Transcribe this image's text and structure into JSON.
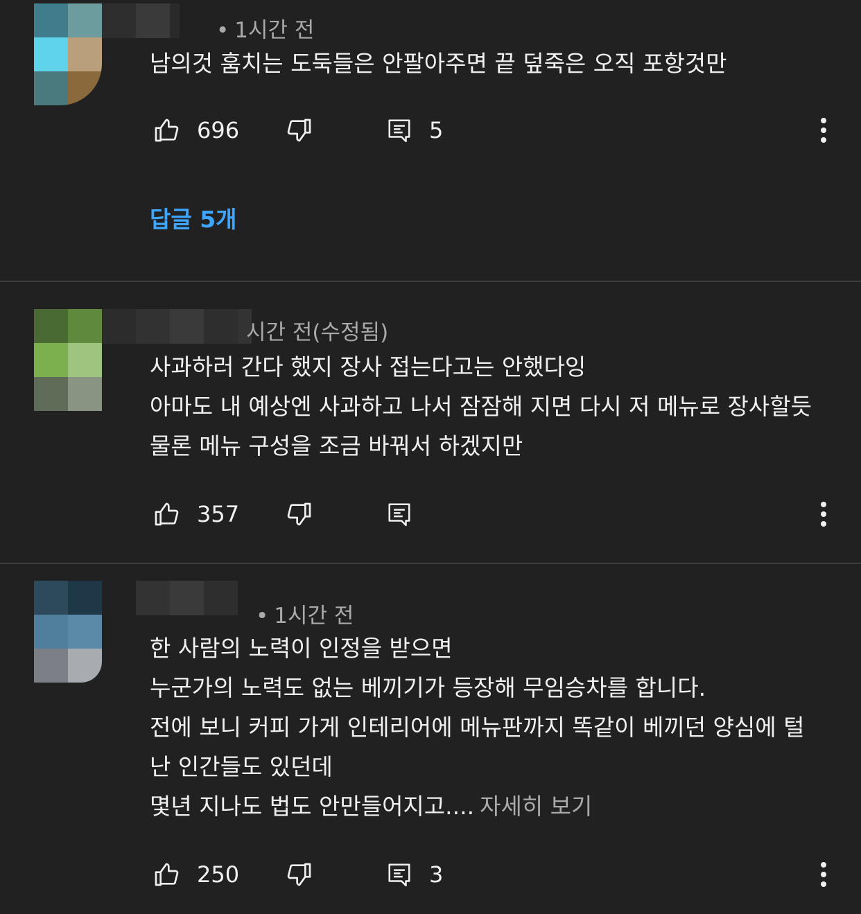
{
  "comments": [
    {
      "meta": "1시간 전",
      "lines": [
        "남의것 훔치는 도둑들은 안팔아주면 끝 덮죽은 오직 포항것만"
      ],
      "likes": "696",
      "replies_count": "5",
      "replies_link": "답글 5개"
    },
    {
      "meta": "시간 전(수정됨)",
      "lines": [
        "사과하러 간다 했지 장사 접는다고는 안했다잉",
        "아마도 내 예상엔 사과하고 나서 잠잠해 지면 다시 저 메뉴로 장사할듯",
        "물론 메뉴 구성을 조금 바꿔서 하겠지만"
      ],
      "likes": "357",
      "replies_count": ""
    },
    {
      "meta": "1시간 전",
      "lines": [
        "한 사람의 노력이 인정을 받으면",
        "누군가의 노력도 없는 베끼기가 등장해 무임승차를 합니다.",
        "전에 보니 커피 가게 인테리어에 메뉴판까지 똑같이 베끼던 양심에 털",
        "난 인간들도 있던데",
        "몇년 지나도 법도 안만들어지고...."
      ],
      "more_label": "자세히 보기",
      "likes": "250",
      "replies_count": "3"
    }
  ],
  "icons": {
    "like": "thumb-up-icon",
    "dislike": "thumb-down-icon",
    "reply": "comment-icon",
    "menu": "more-vert-icon"
  },
  "colors": {
    "background": "#212121",
    "text": "#f1f1f1",
    "secondary": "#aaaaaa",
    "link": "#3ea6ff"
  }
}
